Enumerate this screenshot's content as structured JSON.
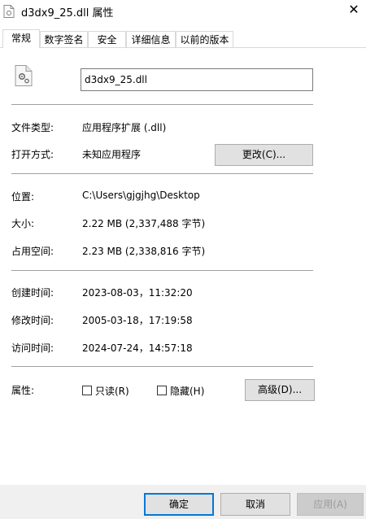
{
  "window": {
    "title": "d3dx9_25.dll 属性",
    "close_glyph": "✕"
  },
  "tabs": [
    {
      "label": "常规"
    },
    {
      "label": "数字签名"
    },
    {
      "label": "安全"
    },
    {
      "label": "详细信息"
    },
    {
      "label": "以前的版本"
    }
  ],
  "file": {
    "name": "d3dx9_25.dll"
  },
  "details": {
    "type_label": "文件类型:",
    "type_value": "应用程序扩展 (.dll)",
    "opens_with_label": "打开方式:",
    "opens_with_value": "未知应用程序",
    "change_button": "更改(C)...",
    "location_label": "位置:",
    "location_value": "C:\\Users\\gjgjhg\\Desktop",
    "size_label": "大小:",
    "size_value": "2.22 MB (2,337,488 字节)",
    "disk_size_label": "占用空间:",
    "disk_size_value": "2.23 MB (2,338,816 字节)",
    "created_label": "创建时间:",
    "created_value": "2023-08-03，11:32:20",
    "modified_label": "修改时间:",
    "modified_value": "2005-03-18，17:19:58",
    "accessed_label": "访问时间:",
    "accessed_value": "2024-07-24，14:57:18",
    "attributes_label": "属性:",
    "readonly_label": "只读(R)",
    "readonly_checked": false,
    "hidden_label": "隐藏(H)",
    "hidden_checked": false,
    "advanced_button": "高级(D)..."
  },
  "footer": {
    "ok_button": "确定",
    "cancel_button": "取消",
    "apply_button": "应用(A)"
  }
}
